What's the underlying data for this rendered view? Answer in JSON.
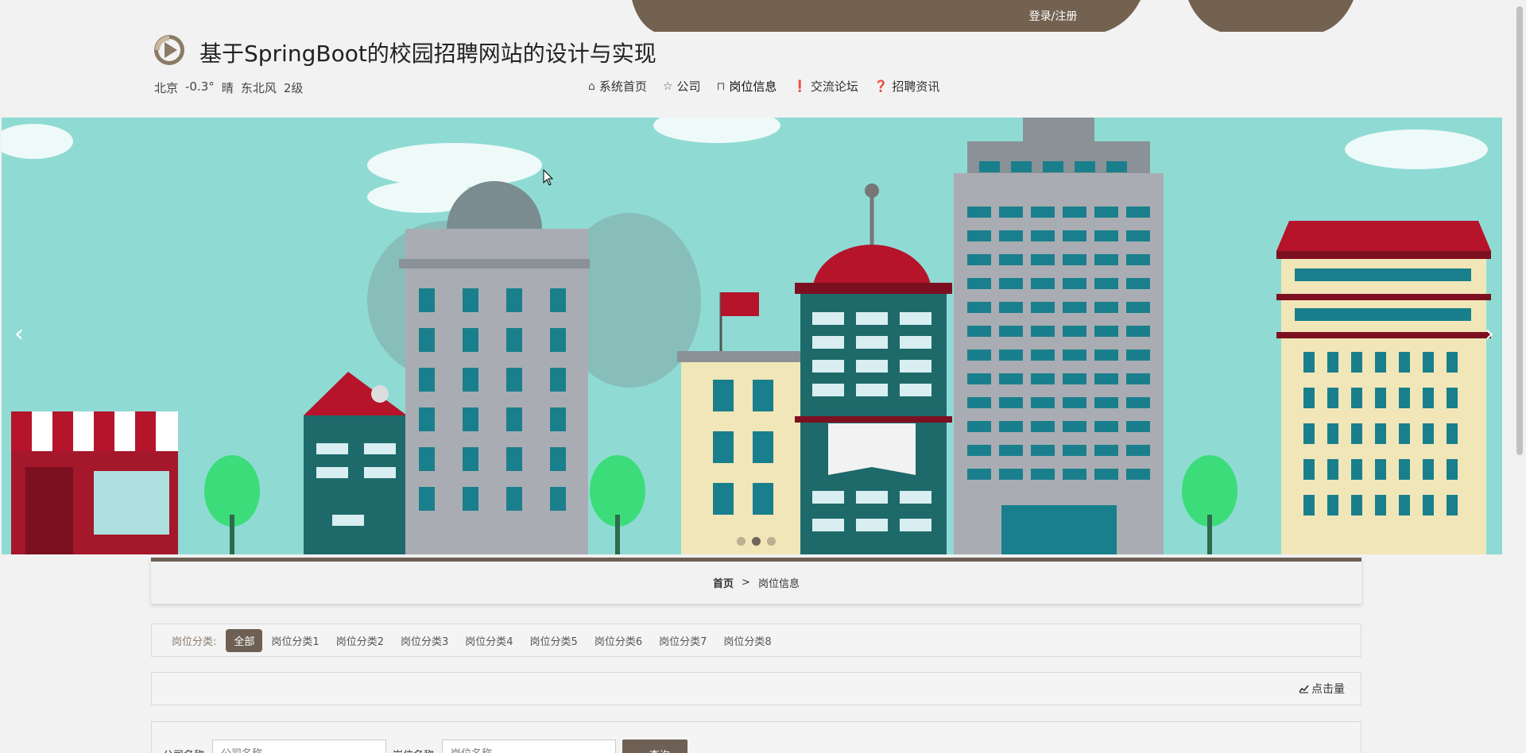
{
  "header": {
    "login_link": "登录/注册",
    "site_title": "基于SpringBoot的校园招聘网站的设计与实现",
    "logo_icon": "play-circle-logo-icon"
  },
  "weather": {
    "city": "北京",
    "temperature": "-0.3°",
    "condition": "晴",
    "wind_direction": "东北风",
    "wind_level": "2级"
  },
  "nav": {
    "items": [
      {
        "label": "系统首页",
        "icon": "home-icon",
        "glyph": "⌂"
      },
      {
        "label": "公司",
        "icon": "star-icon",
        "glyph": "☆"
      },
      {
        "label": "岗位信息",
        "icon": "bag-icon",
        "glyph": "⊓"
      },
      {
        "label": "交流论坛",
        "icon": "info-icon",
        "glyph": "❗"
      },
      {
        "label": "招聘资讯",
        "icon": "question-icon",
        "glyph": "❓"
      }
    ],
    "active_index": 2
  },
  "banner": {
    "prev_glyph": "‹",
    "next_glyph": "›",
    "slide_count": 3,
    "active_slide": 1
  },
  "breadcrumb": {
    "home": "首页",
    "separator": ">",
    "current": "岗位信息"
  },
  "categories": {
    "label": "岗位分类:",
    "items": [
      "全部",
      "岗位分类1",
      "岗位分类2",
      "岗位分类3",
      "岗位分类4",
      "岗位分类5",
      "岗位分类6",
      "岗位分类7",
      "岗位分类8"
    ],
    "active_index": 0
  },
  "sort": {
    "label": "点击量",
    "icon": "chart-icon"
  },
  "search": {
    "company_label": "公司名称",
    "company_placeholder": "公司名称",
    "position_label": "岗位名称",
    "position_placeholder": "岗位名称",
    "button_label": "查询",
    "button_icon": "search-icon"
  },
  "colors": {
    "accent": "#6e6054",
    "banner_sky": "#8fdbd4"
  }
}
